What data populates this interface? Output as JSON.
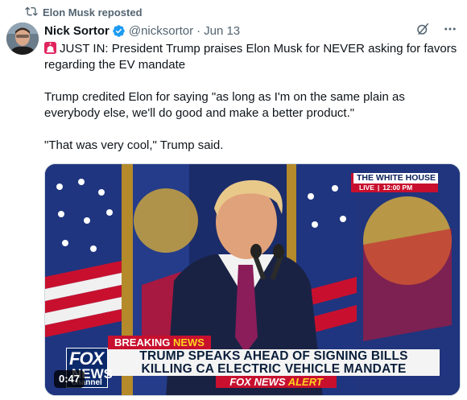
{
  "repost": {
    "label": "Elon Musk reposted",
    "icon": "repost-icon"
  },
  "author": {
    "name": "Nick Sortor",
    "handle": "@nicksortor",
    "separator": "·",
    "date": "Jun 13",
    "verified_color": "#1d9bf0",
    "avatar_icon": "avatar"
  },
  "header_actions": {
    "grok_icon": "grok-icon",
    "more_icon": "more-icon"
  },
  "post": {
    "line1": "JUST IN: President Trump praises Elon Musk for NEVER asking for favors regarding the EV mandate",
    "line2": "Trump credited Elon for saying \"as long as I'm on the same plain as everybody else, we'll do good and make a better product.\"",
    "line3": "\"That was very cool,\" Trump said."
  },
  "media": {
    "wh_title": "THE WHITE HOUSE",
    "wh_live": "LIVE",
    "wh_sep": "|",
    "wh_time": "12:00 PM",
    "breaking": "BREAKING",
    "breaking_news": "NEWS",
    "headline_1": "TRUMP SPEAKS AHEAD OF SIGNING BILLS",
    "headline_2": "KILLING CA ELECTRIC VEHICLE MANDATE",
    "alert_1": "FOX NEWS",
    "alert_2": "ALERT",
    "logo_1": "FOX",
    "logo_2": "NEWS",
    "logo_3": "channel",
    "duration": "0:47"
  }
}
